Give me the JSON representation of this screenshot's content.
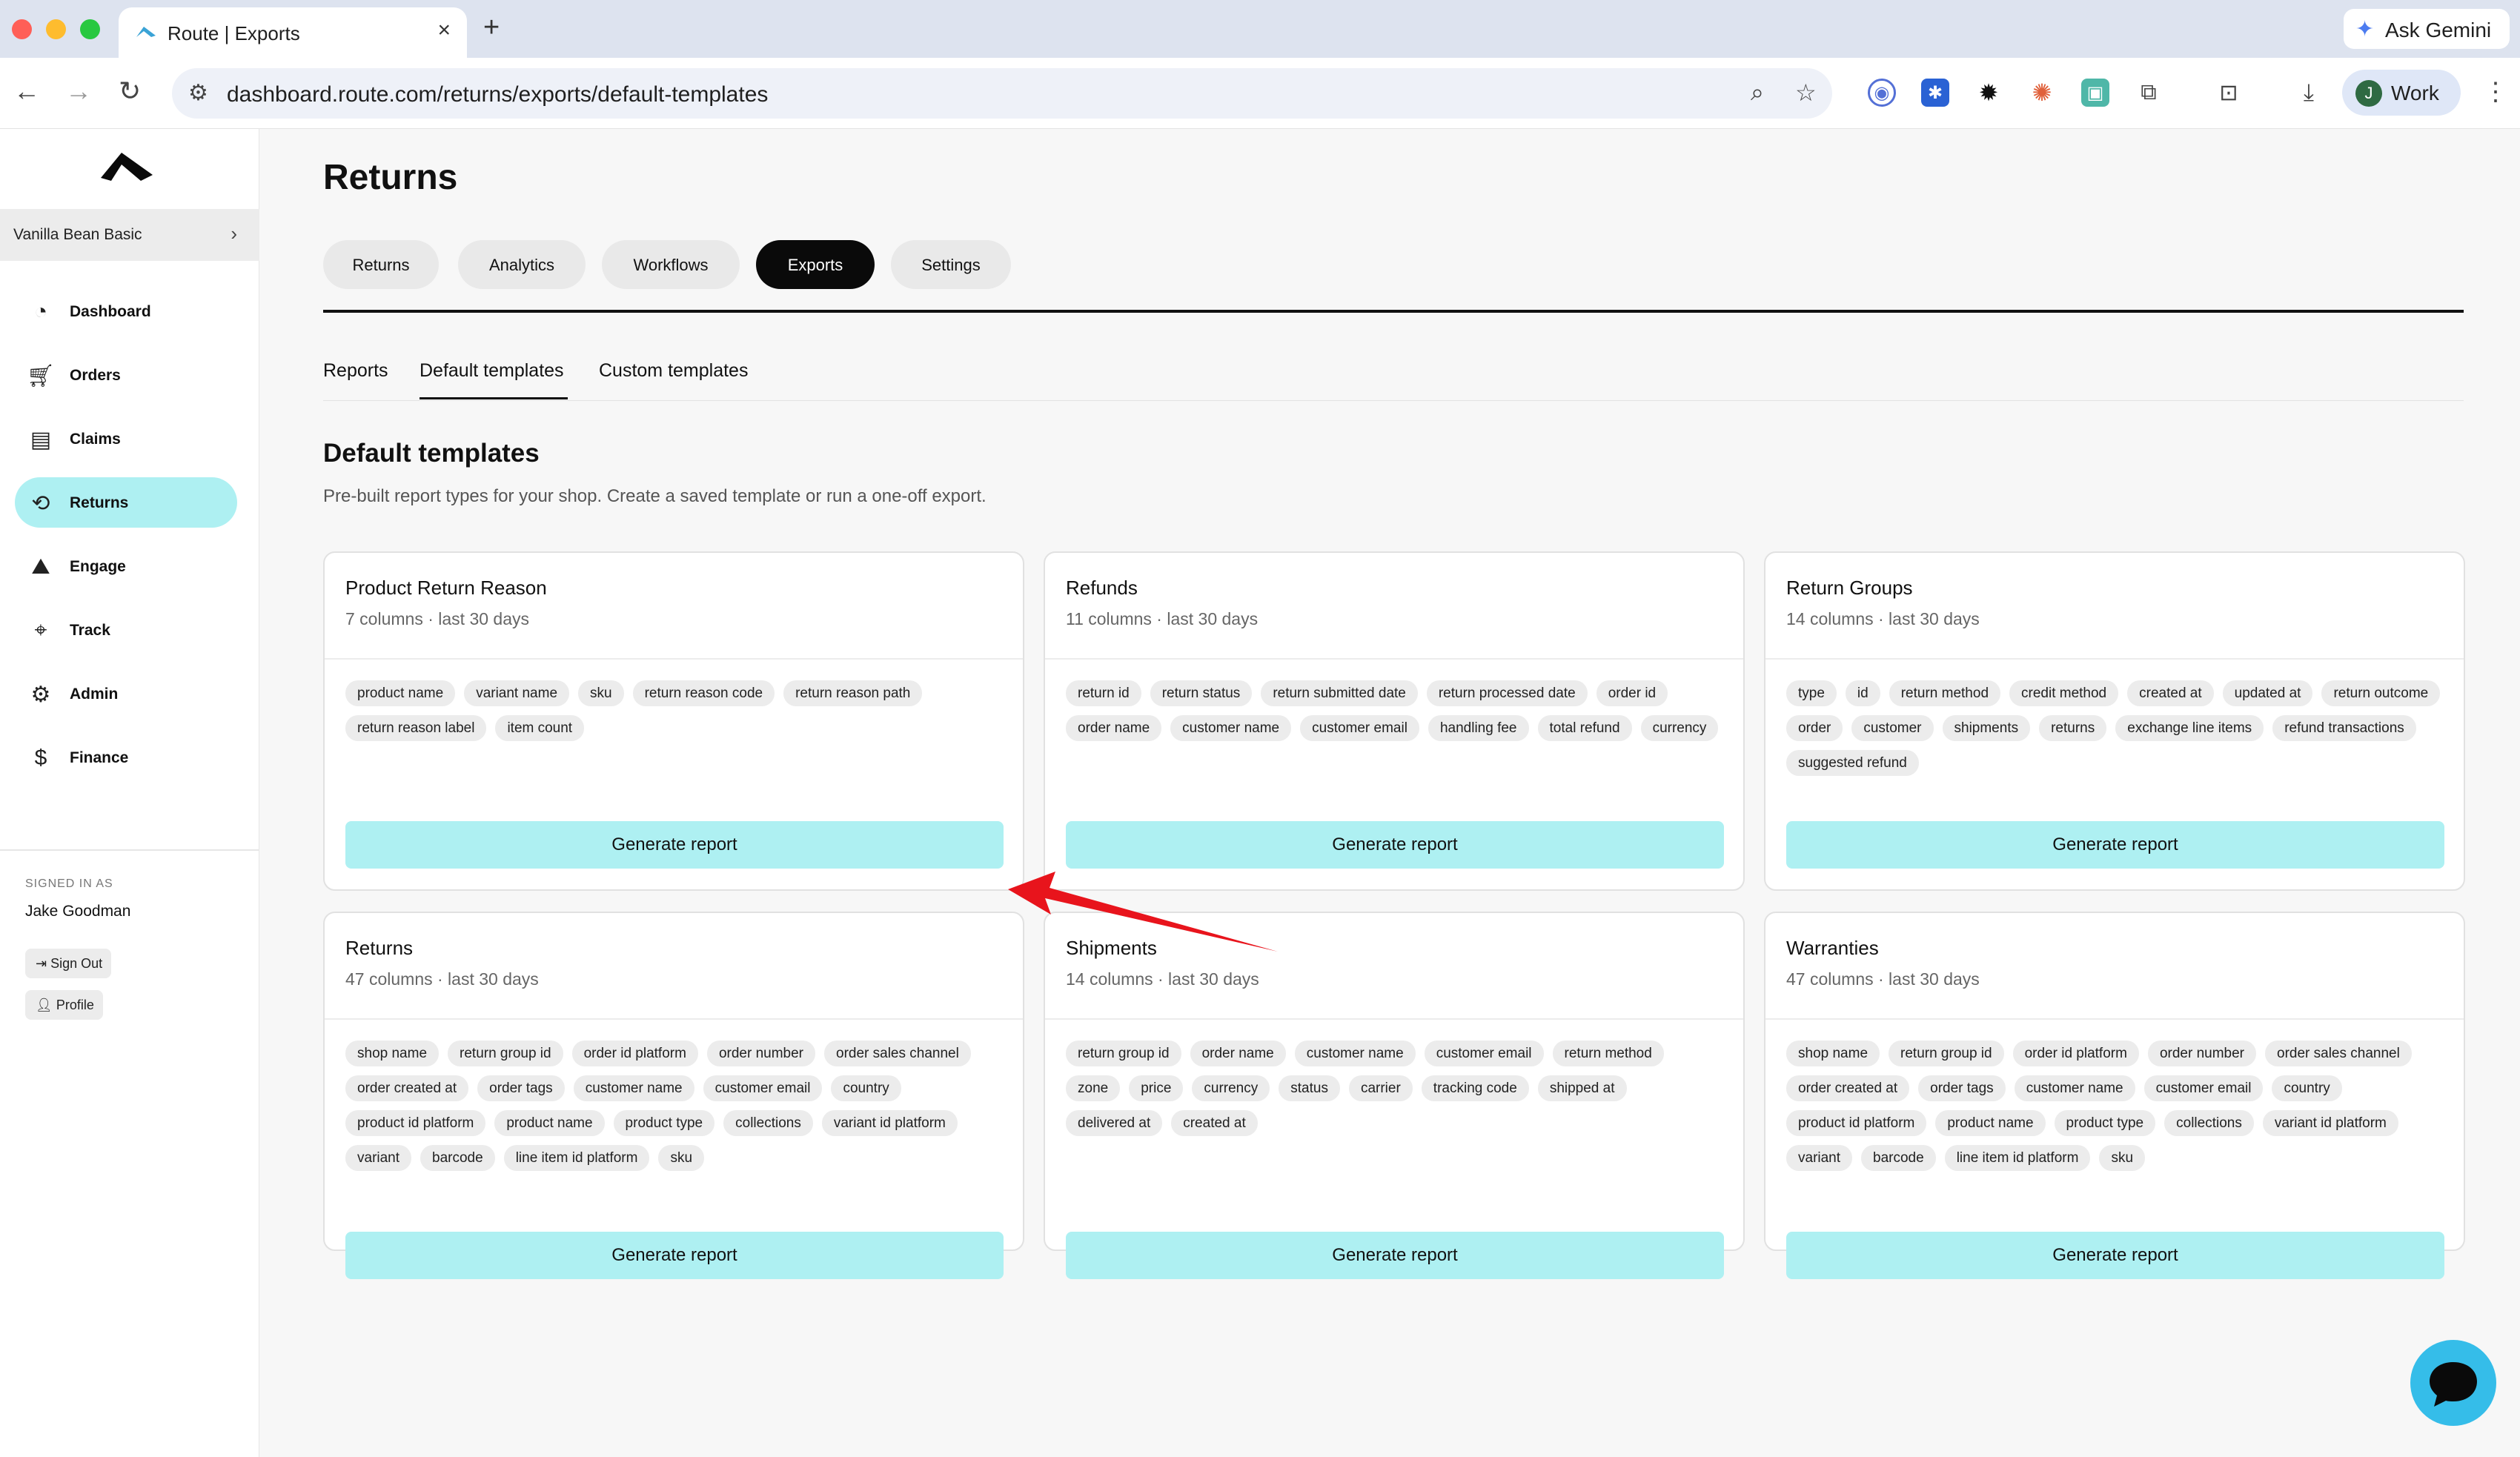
{
  "browser": {
    "tab_title": "Route | Exports",
    "close_glyph": "×",
    "new_tab_glyph": "+",
    "gemini_label": "Ask Gemini",
    "url": "dashboard.route.com/returns/exports/default-templates",
    "profile_initial": "J",
    "profile_label": "Work",
    "traffic_colors": [
      "#ff5f57",
      "#febc2e",
      "#28c840"
    ]
  },
  "sidebar": {
    "store": "Vanilla Bean Basic",
    "nav": [
      {
        "label": "Dashboard",
        "icon": "speedometer-icon"
      },
      {
        "label": "Orders",
        "icon": "cart-icon"
      },
      {
        "label": "Claims",
        "icon": "claims-icon"
      },
      {
        "label": "Returns",
        "icon": "returns-icon",
        "active": true
      },
      {
        "label": "Engage",
        "icon": "image-icon"
      },
      {
        "label": "Track",
        "icon": "location-pin-icon"
      },
      {
        "label": "Admin",
        "icon": "gear-icon"
      },
      {
        "label": "Finance",
        "icon": "money-bag-icon"
      }
    ],
    "signed_in_caption": "SIGNED IN AS",
    "user_name": "Jake Goodman",
    "sign_out": "Sign Out",
    "profile": "Profile"
  },
  "main": {
    "title": "Returns",
    "tabs": [
      "Returns",
      "Analytics",
      "Workflows",
      "Exports",
      "Settings"
    ],
    "active_tab": "Exports",
    "subtabs": [
      "Reports",
      "Default templates",
      "Custom templates"
    ],
    "active_subtab": "Default templates",
    "section_title": "Default templates",
    "section_desc": "Pre-built report types for your shop. Create a saved template or run a one-off export.",
    "button_label": "Generate report",
    "cards": [
      {
        "name": "Product Return Reason",
        "meta": "7 columns · last 30 days",
        "columns": [
          "product name",
          "variant name",
          "sku",
          "return reason code",
          "return reason path",
          "return reason label",
          "item count"
        ]
      },
      {
        "name": "Refunds",
        "meta": "11 columns · last 30 days",
        "columns": [
          "return id",
          "return status",
          "return submitted date",
          "return processed date",
          "order id",
          "order name",
          "customer name",
          "customer email",
          "handling fee",
          "total refund",
          "currency"
        ]
      },
      {
        "name": "Return Groups",
        "meta": "14 columns · last 30 days",
        "columns": [
          "type",
          "id",
          "return method",
          "credit method",
          "created at",
          "updated at",
          "return outcome",
          "order",
          "customer",
          "shipments",
          "returns",
          "exchange line items",
          "refund transactions",
          "suggested refund"
        ]
      },
      {
        "name": "Returns",
        "meta": "47 columns · last 30 days",
        "columns": [
          "shop name",
          "return group id",
          "order id platform",
          "order number",
          "order sales channel",
          "order created at",
          "order tags",
          "customer name",
          "customer email",
          "country",
          "product id platform",
          "product name",
          "product type",
          "collections",
          "variant id platform",
          "variant",
          "barcode",
          "line item id platform",
          "sku"
        ]
      },
      {
        "name": "Shipments",
        "meta": "14 columns · last 30 days",
        "columns": [
          "return group id",
          "order name",
          "customer name",
          "customer email",
          "return method",
          "zone",
          "price",
          "currency",
          "status",
          "carrier",
          "tracking code",
          "shipped at",
          "delivered at",
          "created at"
        ]
      },
      {
        "name": "Warranties",
        "meta": "47 columns · last 30 days",
        "columns": [
          "shop name",
          "return group id",
          "order id platform",
          "order number",
          "order sales channel",
          "order created at",
          "order tags",
          "customer name",
          "customer email",
          "country",
          "product id platform",
          "product name",
          "product type",
          "collections",
          "variant id platform",
          "variant",
          "barcode",
          "line item id platform",
          "sku"
        ]
      }
    ]
  },
  "colors": {
    "accent": "#aef0f2",
    "annotation_arrow": "#e8141c",
    "chat_button": "#35bde9"
  }
}
